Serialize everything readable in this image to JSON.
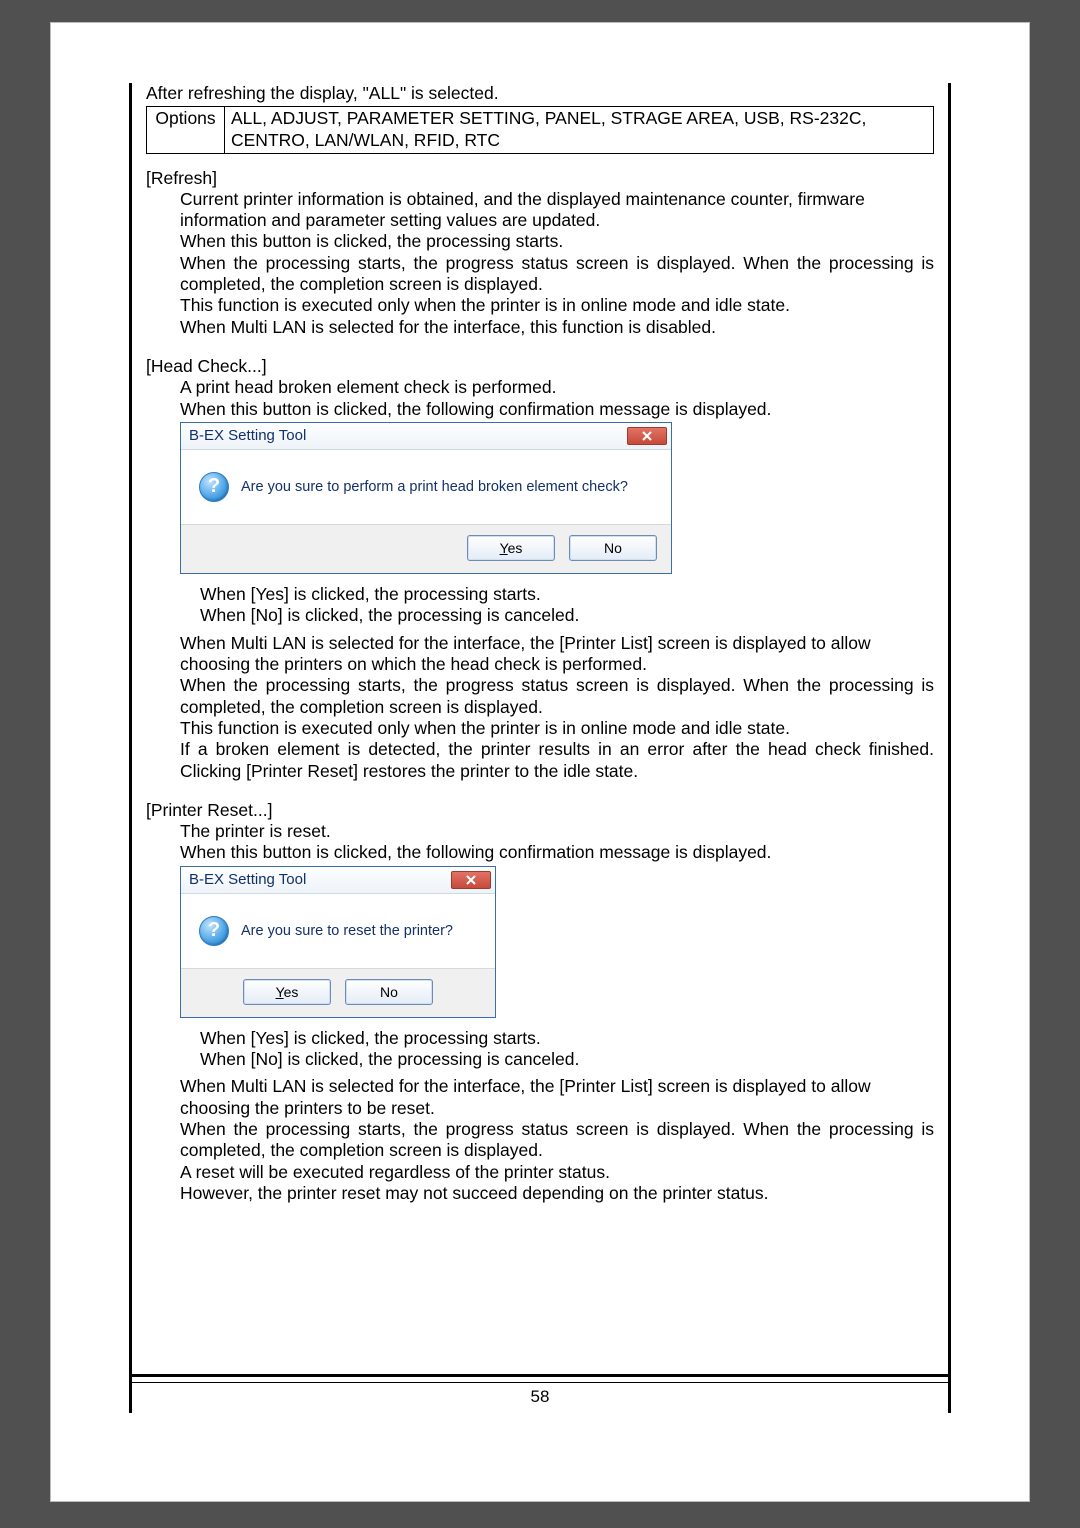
{
  "intro": "After refreshing the display, \"ALL\" is selected.",
  "options_table": {
    "label": "Options",
    "value": "ALL, ADJUST, PARAMETER SETTING, PANEL, STRAGE AREA, USB, RS-232C, CENTRO, LAN/WLAN, RFID, RTC"
  },
  "refresh": {
    "title": "[Refresh]",
    "p1": "Current printer information is obtained, and the displayed maintenance counter, firmware information and parameter setting values are updated.",
    "p2": "When this button is clicked, the processing starts.",
    "p3": "When the processing starts, the progress status screen is displayed.   When the processing is completed, the completion screen is displayed.",
    "p4": "This function is executed only when the printer is in online mode and idle state.",
    "p5": "When Multi LAN is selected for the interface, this function is disabled."
  },
  "headcheck": {
    "title": "[Head Check...]",
    "p1": "A print head broken element check is performed.",
    "p2": "When this button is clicked, the following confirmation message is displayed.",
    "dialog": {
      "title": "B-EX Setting Tool",
      "message": "Are you sure to perform a print head broken element check?",
      "yes": "Yes",
      "no": "No"
    },
    "p3": "When [Yes] is clicked, the processing starts.",
    "p4": "When [No] is clicked, the processing is canceled.",
    "p5": "When Multi LAN is selected for the interface, the [Printer List] screen is displayed to allow choosing the printers on which the head check is performed.",
    "p6": "When the processing starts, the progress status screen is displayed.   When the processing is completed, the completion screen is displayed.",
    "p7": "This function is executed only when the printer is in online mode and idle state.",
    "p8": "If a broken element is detected, the printer results in an error after the head check finished.   Clicking [Printer Reset] restores the printer to the idle state."
  },
  "reset": {
    "title": "[Printer Reset...]",
    "p1": "The printer is reset.",
    "p2": "When this button is clicked, the following confirmation message is displayed.",
    "dialog": {
      "title": "B-EX Setting Tool",
      "message": "Are you sure to reset the printer?",
      "yes": "Yes",
      "no": "No"
    },
    "p3": "When [Yes] is clicked, the processing starts.",
    "p4": "When [No] is clicked, the processing is canceled.",
    "p5": "When Multi LAN is selected for the interface, the [Printer List] screen is displayed to allow choosing the printers to be reset.",
    "p6": "When the processing starts, the progress status screen is displayed.   When the processing is completed, the completion screen is displayed.",
    "p7": "A reset will be executed regardless of the printer status.",
    "p8": "However, the printer reset may not succeed depending on the printer status."
  },
  "page_number": "58"
}
